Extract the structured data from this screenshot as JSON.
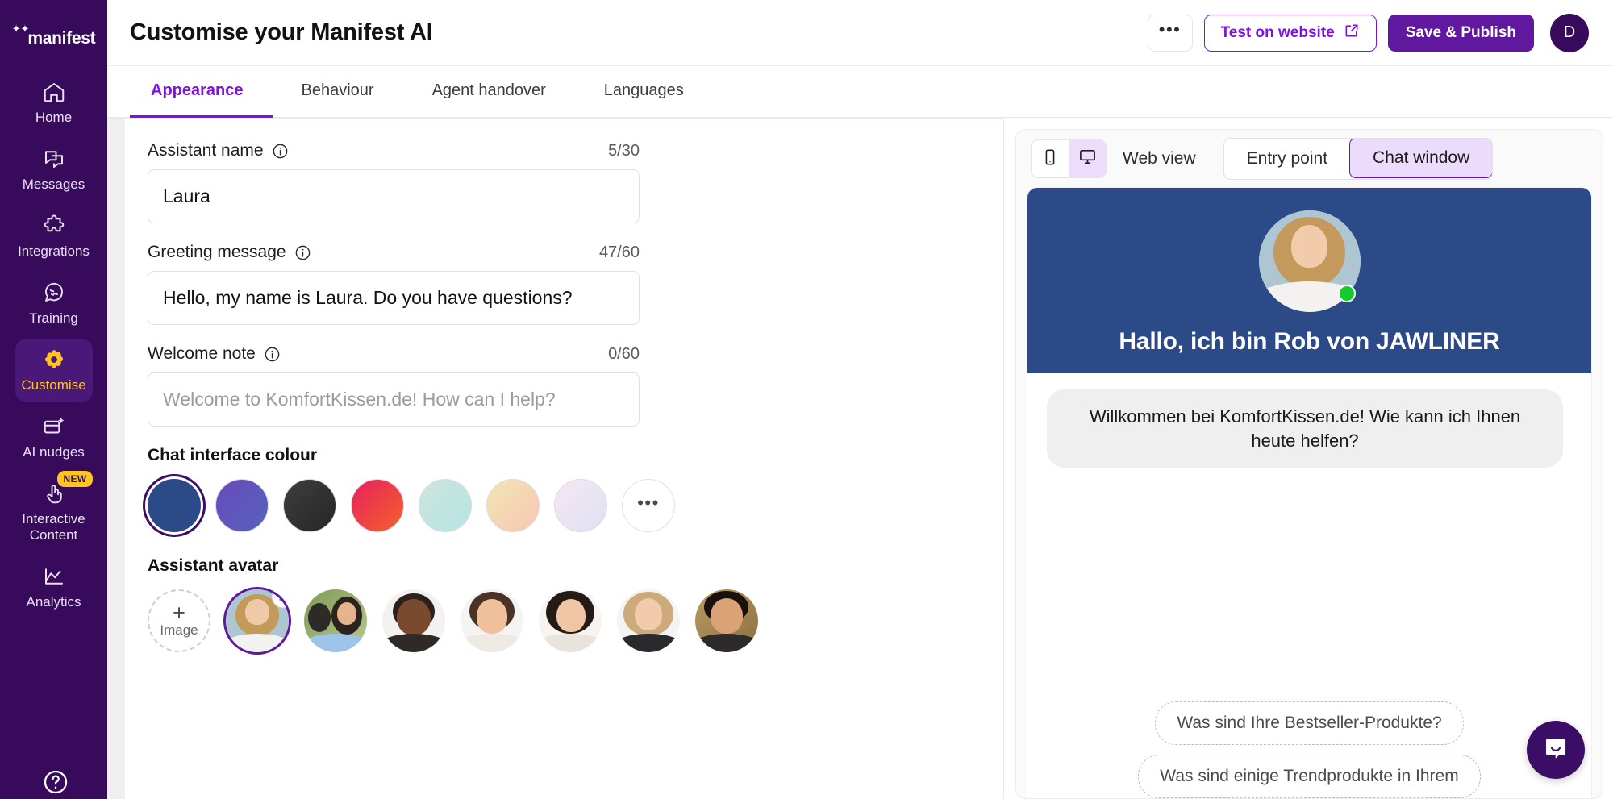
{
  "sidebar": {
    "brand": "manifest",
    "items": [
      {
        "label": "Home",
        "icon": "home-icon",
        "active": false
      },
      {
        "label": "Messages",
        "icon": "messages-icon",
        "active": false
      },
      {
        "label": "Integrations",
        "icon": "puzzle-icon",
        "active": false
      },
      {
        "label": "Training",
        "icon": "brain-icon",
        "active": false
      },
      {
        "label": "Customise",
        "icon": "gear-icon",
        "active": true
      },
      {
        "label": "AI nudges",
        "icon": "nudge-icon",
        "active": false
      },
      {
        "label": "Interactive Content",
        "icon": "hand-pointer-icon",
        "active": false,
        "badge": "NEW"
      },
      {
        "label": "Analytics",
        "icon": "chart-line-icon",
        "active": false
      }
    ],
    "help_icon": "help-circle-icon",
    "active_color": "#FFC422",
    "background": "#380a5c"
  },
  "header": {
    "title": "Customise your Manifest AI",
    "ellipsis_label": "•••",
    "test_label": "Test on website",
    "test_icon": "external-link-icon",
    "save_label": "Save & Publish",
    "avatar_initial": "D",
    "accent": "#7d12e0",
    "primary": "#5f189e"
  },
  "tabs": [
    {
      "label": "Appearance",
      "active": true
    },
    {
      "label": "Behaviour",
      "active": false
    },
    {
      "label": "Agent handover",
      "active": false
    },
    {
      "label": "Languages",
      "active": false
    }
  ],
  "form": {
    "assistant_name": {
      "label": "Assistant name",
      "counter": "5/30",
      "value": "Laura",
      "placeholder": "Assistant name"
    },
    "greeting_message": {
      "label": "Greeting message",
      "counter": "47/60",
      "value": "Hello, my name is Laura. Do you have questions?",
      "placeholder": "Greeting message"
    },
    "welcome_note": {
      "label": "Welcome note",
      "counter": "0/60",
      "value": "",
      "placeholder": "Welcome to KomfortKissen.de! How can I help?"
    },
    "colour_section_title": "Chat interface colour",
    "colours": [
      {
        "name": "navy",
        "css": "#2c4a88",
        "selected": true
      },
      {
        "name": "violet",
        "css": "linear-gradient(135deg,#6b4bbd,#5462bb)",
        "selected": false
      },
      {
        "name": "charcoal",
        "css": "linear-gradient(135deg,#3c3c3c,#2a2a2a)",
        "selected": false
      },
      {
        "name": "crimson-orange",
        "css": "linear-gradient(135deg,#e8205f,#f4622a)",
        "selected": false
      },
      {
        "name": "mint",
        "css": "linear-gradient(135deg,#cfe3dc,#b8e6e2)",
        "selected": false
      },
      {
        "name": "peach",
        "css": "linear-gradient(135deg,#f2e6b8,#f6c8b4)",
        "selected": false
      },
      {
        "name": "lilac",
        "css": "linear-gradient(135deg,#f3e6f0,#dfe0f2)",
        "selected": false
      }
    ],
    "colour_more_label": "•••",
    "avatar_section_title": "Assistant avatar",
    "avatar_add_label": "Image",
    "avatar_add_plus": "+",
    "avatar_remove_label": "✕",
    "avatars": [
      {
        "name": "blonde-woman-white-shirt",
        "selected": true
      },
      {
        "name": "two-agents-headset",
        "selected": false
      },
      {
        "name": "man-headset-smiling",
        "selected": false
      },
      {
        "name": "woman-headset-smiling",
        "selected": false
      },
      {
        "name": "woman-dark-hair-laughing",
        "selected": false
      },
      {
        "name": "blonde-woman-headset",
        "selected": false
      },
      {
        "name": "man-dark-hair-headset",
        "selected": false
      }
    ]
  },
  "preview": {
    "device_phone_icon": "phone-icon",
    "device_desktop_icon": "monitor-icon",
    "webview_label": "Web view",
    "segments": [
      {
        "label": "Entry point",
        "active": false
      },
      {
        "label": "Chat window",
        "active": true
      }
    ],
    "chat": {
      "header_colour": "#2c4a88",
      "title": "Hallo, ich bin Rob von JAWLINER",
      "online_status": "online",
      "message": "Willkommen bei KomfortKissen.de! Wie kann ich Ihnen heute helfen?",
      "suggestions": [
        "Was sind Ihre Bestseller-Produkte?",
        "Was sind einige Trendprodukte in Ihrem"
      ],
      "launcher_icon": "chat-bubble-icon"
    }
  }
}
